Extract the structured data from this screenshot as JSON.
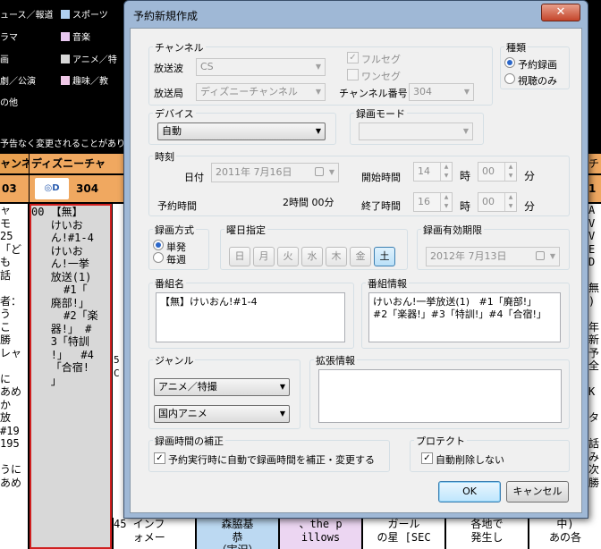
{
  "epg": {
    "legend": {
      "rows": [
        {
          "left": "ュース／報道",
          "right": "スポーツ",
          "right_color": "#b0d0f0"
        },
        {
          "left": "ラマ",
          "right": "音楽",
          "right_color": "#e8c8f0"
        },
        {
          "left": "画",
          "right": "アニメ／特",
          "right_color": "#d8d8d8"
        },
        {
          "left": "劇／公演",
          "right": "趣味／教",
          "right_color": "#f0c8e8"
        },
        {
          "left": "の他",
          "right": "",
          "right_color": ""
        }
      ]
    },
    "notice": "予告なく変更されることがありま",
    "channel_header_left": "ャンネ",
    "channel_header": "ディズニーチャ",
    "channel_header_right": "チ",
    "channel_num_left": "03",
    "channel_num": "304",
    "channel_num_right": "1",
    "left_col_text": "ャ\nモ\n25\n「ど\nも\n話\n\n者：\nう\nこ\n勝\nレャ\n\nに\nあめ\nか\n放\n#19\n195\n\nうに\nあめ",
    "main_col_text": "00 【無】\n   けいお\n   ん!#1-4\n   けいお\n   ん!一挙\n   放送(1)\n     #1「\n   廃部!」\n     #2「楽\n   器!」 #\n   3「特訓\n   !」  #4\n   「合宿!\n   」",
    "main_col_mark": "5C",
    "right_col_text": "AV\nVE\nD\n\n無\n)\n\n年\n新\n予\n全\n\nK\n\nタ\n\n話\nみ\n次\n勝",
    "bottom_cells": [
      {
        "text": "45 インフ\n   ォメー",
        "bg": "#fff"
      },
      {
        "text": "森脇基\n恭\n（実況）",
        "bg": "#bcd9f2"
      },
      {
        "text": "、the p\nillows",
        "bg": "#ecd6f2"
      },
      {
        "text": "ガール\nの星 [SEC",
        "bg": "#fff"
      },
      {
        "text": "各地で\n発生し",
        "bg": "#fff"
      },
      {
        "text": "中)\nあの各",
        "bg": "#fff"
      }
    ]
  },
  "dialog": {
    "title": "予約新規作成",
    "close_label": "✕",
    "channel": {
      "group_label": "チャンネル",
      "broadcast_wave_label": "放送波",
      "broadcast_wave_value": "CS",
      "station_label": "放送局",
      "station_value": "ディズニーチャンネル",
      "fullseg_label": "フルセグ",
      "oneseg_label": "ワンセグ",
      "channel_number_label": "チャンネル番号",
      "channel_number_value": "304"
    },
    "kind": {
      "group_label": "種類",
      "options": [
        "予約録画",
        "視聴のみ"
      ]
    },
    "device": {
      "group_label": "デバイス",
      "value": "自動"
    },
    "rec_mode": {
      "group_label": "録画モード",
      "value": ""
    },
    "time": {
      "group_label": "時刻",
      "date_label": "日付",
      "date_value": "2011年  7月16日",
      "start_label": "開始時間",
      "start_hour": "14",
      "start_min": "00",
      "hour_unit": "時",
      "min_unit": "分",
      "reserve_time_label": "予約時間",
      "reserve_time_value": "2時間 00分",
      "end_label": "終了時間",
      "end_hour": "16",
      "end_min": "00"
    },
    "rec_method": {
      "group_label": "録画方式",
      "options": [
        "単発",
        "毎週"
      ]
    },
    "weekday": {
      "group_label": "曜日指定",
      "days": [
        "日",
        "月",
        "火",
        "水",
        "木",
        "金",
        "土"
      ]
    },
    "expiry": {
      "group_label": "録画有効期限",
      "value": "2012年  7月13日"
    },
    "program_name": {
      "group_label": "番組名",
      "value": "【無】けいおん!#1-4"
    },
    "program_info": {
      "group_label": "番組情報",
      "value": "けいおん!一挙放送(1)   #1「廃部!」\n#2「楽器!」#3「特訓!」#4「合宿!」"
    },
    "genre": {
      "group_label": "ジャンル",
      "main_value": "アニメ／特撮",
      "sub_value": "国内アニメ"
    },
    "ext_info": {
      "group_label": "拡張情報",
      "value": ""
    },
    "rec_correction": {
      "group_label": "録画時間の補正",
      "checkbox_label": "予約実行時に自動で録画時間を補正・変更する"
    },
    "protect": {
      "group_label": "プロテクト",
      "checkbox_label": "自動削除しない"
    },
    "ok_label": "OK",
    "cancel_label": "キャンセル"
  }
}
